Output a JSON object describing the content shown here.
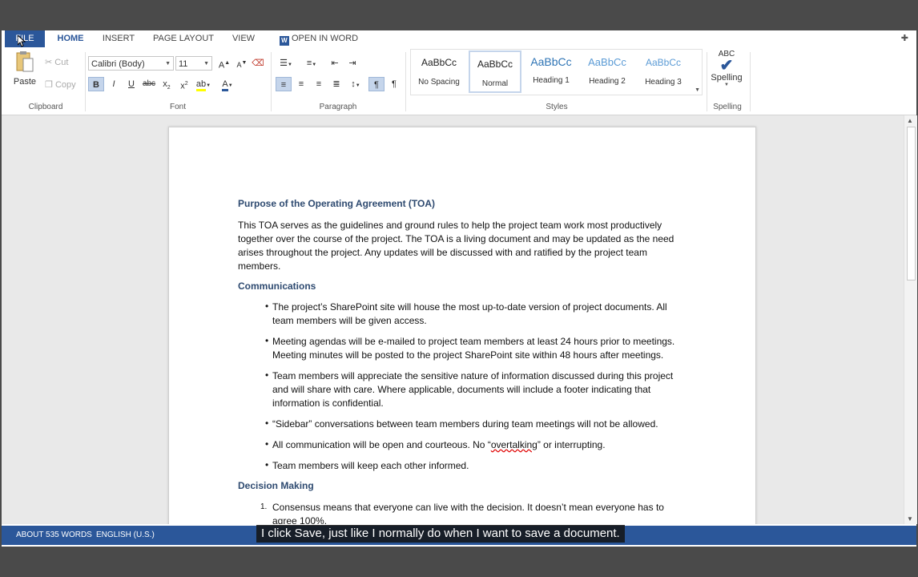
{
  "tabs": {
    "file": "FILE",
    "home": "HOME",
    "insert": "INSERT",
    "page_layout": "PAGE LAYOUT",
    "view": "VIEW",
    "open_in_word": "OPEN IN WORD"
  },
  "ribbon": {
    "clipboard": {
      "paste": "Paste",
      "cut": "Cut",
      "copy": "Copy",
      "label": "Clipboard"
    },
    "font": {
      "font_name": "Calibri (Body)",
      "font_size": "11",
      "label": "Font"
    },
    "paragraph": {
      "label": "Paragraph"
    },
    "styles": {
      "label": "Styles",
      "items": [
        {
          "sample": "AaBbCc",
          "name": "No Spacing"
        },
        {
          "sample": "AaBbCc",
          "name": "Normal"
        },
        {
          "sample": "AaBbCc",
          "name": "Heading 1"
        },
        {
          "sample": "AaBbCc",
          "name": "Heading 2"
        },
        {
          "sample": "AaBbCc",
          "name": "Heading 3"
        }
      ]
    },
    "spelling": {
      "abc": "ABC",
      "button": "Spelling",
      "label": "Spelling"
    }
  },
  "document": {
    "heading1": "Purpose of the Operating Agreement (TOA)",
    "para1": "This TOA serves as the guidelines and ground rules to help the project team work most productively together over the course of the project. The TOA is a living document and may be updated as the need arises throughout the project. Any updates will be discussed with and ratified by the project team members.",
    "heading2": "Communications",
    "bullets": [
      "The project’s SharePoint site will house the most up-to-date version of project documents. All team members will be given access.",
      "Meeting agendas will be e-mailed to project team members at least 24 hours prior to meetings. Meeting minutes will be posted to the project SharePoint site within 48 hours after meetings.",
      "Team members will appreciate the sensitive nature of information discussed during this project and will share with care. Where applicable, documents will include a footer indicating that information is confidential.",
      "“Sidebar” conversations between team members during team meetings will not be allowed.",
      "Team members will keep each other informed."
    ],
    "bullet5_pre": "All communication will be open and courteous. No “",
    "bullet5_misspelled": "overtalking",
    "bullet5_post": "” or interrupting.",
    "heading3": "Decision Making",
    "numbered1_num": "1.",
    "numbered1": "Consensus means that everyone can live with the decision. It doesn’t mean everyone has to agree 100%."
  },
  "status": {
    "words": "ABOUT 535 WORDS",
    "language": "ENGLISH (U.S.)"
  },
  "caption": "I click Save, just like I normally do when I want to save a document.",
  "colors": {
    "accent": "#2b579a",
    "heading": "#2e4a70"
  }
}
